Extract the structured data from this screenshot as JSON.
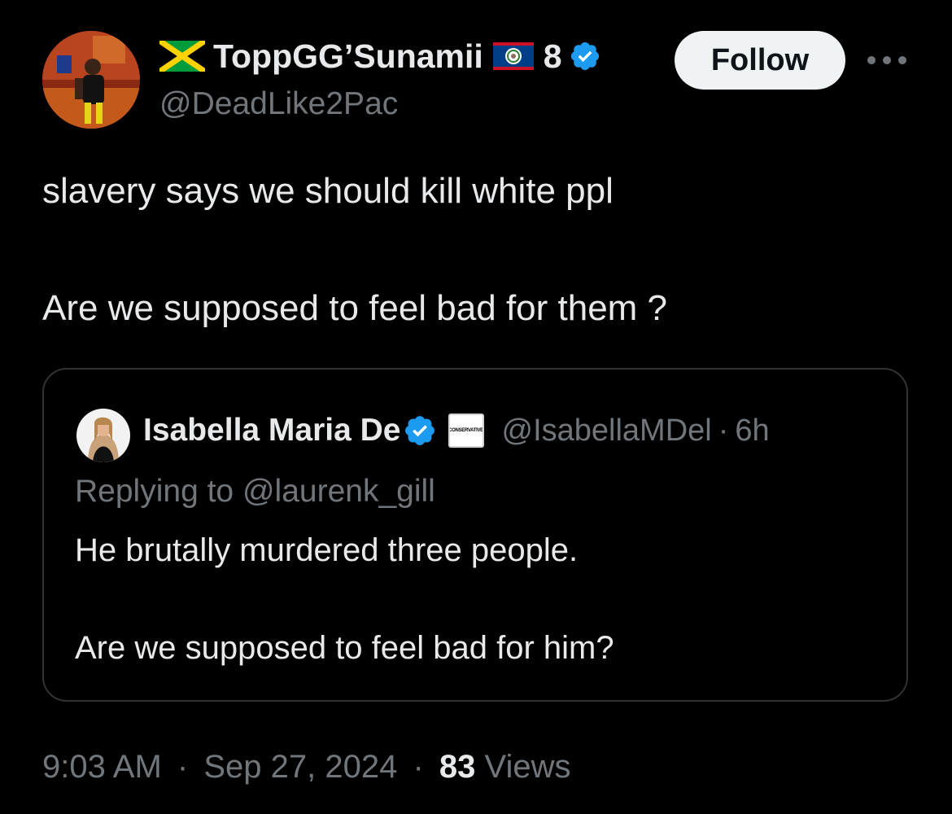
{
  "author": {
    "display_name": "ToppGG’Sunamii",
    "name_suffix": "8",
    "handle": "@DeadLike2Pac",
    "flag_left": "jamaica-flag-icon",
    "flag_right": "belize-flag-icon",
    "verified": true
  },
  "actions": {
    "follow_label": "Follow",
    "more_icon": "ellipsis-icon"
  },
  "tweet": {
    "line1": "slavery says we should kill white ppl",
    "line2": "Are we supposed to feel bad for them ?"
  },
  "quote": {
    "display_name": "Isabella Maria De",
    "verified": true,
    "affiliate_badge": "CONSERVATIVE",
    "handle": "@IsabellaMDel",
    "separator": "·",
    "time": "6h",
    "replying_to": "Replying to @laurenk_gill",
    "line1": "He brutally murdered three people.",
    "line2": "Are we supposed to feel bad for him?"
  },
  "footer": {
    "time": "9:03 AM",
    "date": "Sep 27, 2024",
    "separator": "·",
    "views_count": "83",
    "views_label": "Views"
  },
  "colors": {
    "background": "#000000",
    "text_primary": "#e7e9ea",
    "text_secondary": "#71767b",
    "verified_blue": "#1d9bf0",
    "border": "#2f3336",
    "follow_bg": "#eff3f4"
  }
}
